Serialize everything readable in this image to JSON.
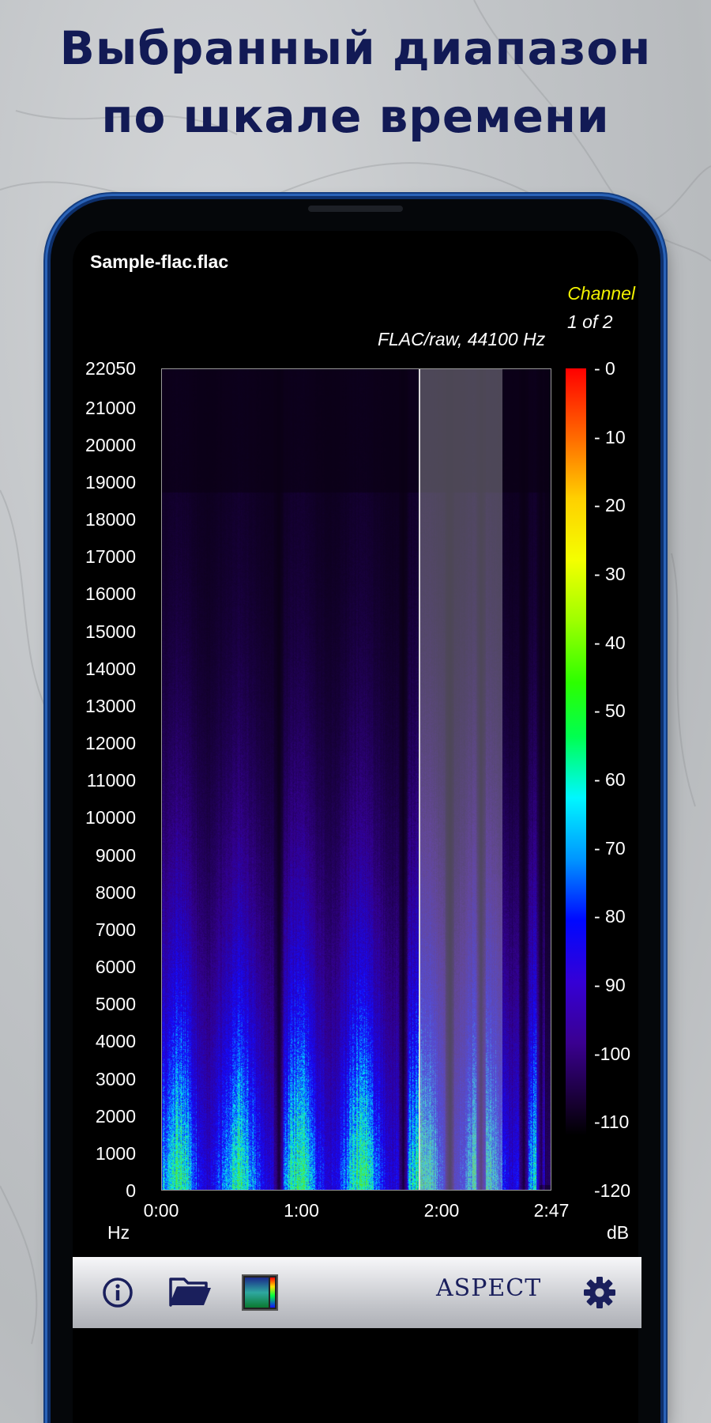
{
  "headline": {
    "line1": "Выбранный диапазон",
    "line2": "по шкале времени"
  },
  "screen": {
    "file_name": "Sample-flac.flac",
    "channel_label": "Channel",
    "channel_count": "1 of 2",
    "format": "FLAC/raw, 44100 Hz",
    "hz_unit": "Hz",
    "db_unit": "dB"
  },
  "spectrogram": {
    "y_ticks": [
      "22050",
      "21000",
      "20000",
      "19000",
      "18000",
      "17000",
      "16000",
      "15000",
      "14000",
      "13000",
      "12000",
      "11000",
      "10000",
      "9000",
      "8000",
      "7000",
      "6000",
      "5000",
      "4000",
      "3000",
      "2000",
      "1000",
      "0"
    ],
    "x_ticks": [
      "0:00",
      "1:00",
      "2:00",
      "2:47"
    ],
    "db_ticks": [
      "- 0",
      "- 10",
      "- 20",
      "- 30",
      "- 40",
      "- 50",
      "- 60",
      "- 70",
      "- 80",
      "- 90",
      "-100",
      "-110",
      "-120"
    ],
    "duration_seconds": 167,
    "selection_start_seconds": 110,
    "selection_end_seconds": 145
  },
  "toolbar": {
    "brand": "ASPECT",
    "icons": [
      "info-icon",
      "folder-open-icon",
      "spectrogram-thumbnail-icon",
      "gear-icon"
    ]
  },
  "colors": {
    "headline": "#121a55",
    "channel": "#f2f200",
    "toolbar_icon": "#1a1f5c"
  }
}
